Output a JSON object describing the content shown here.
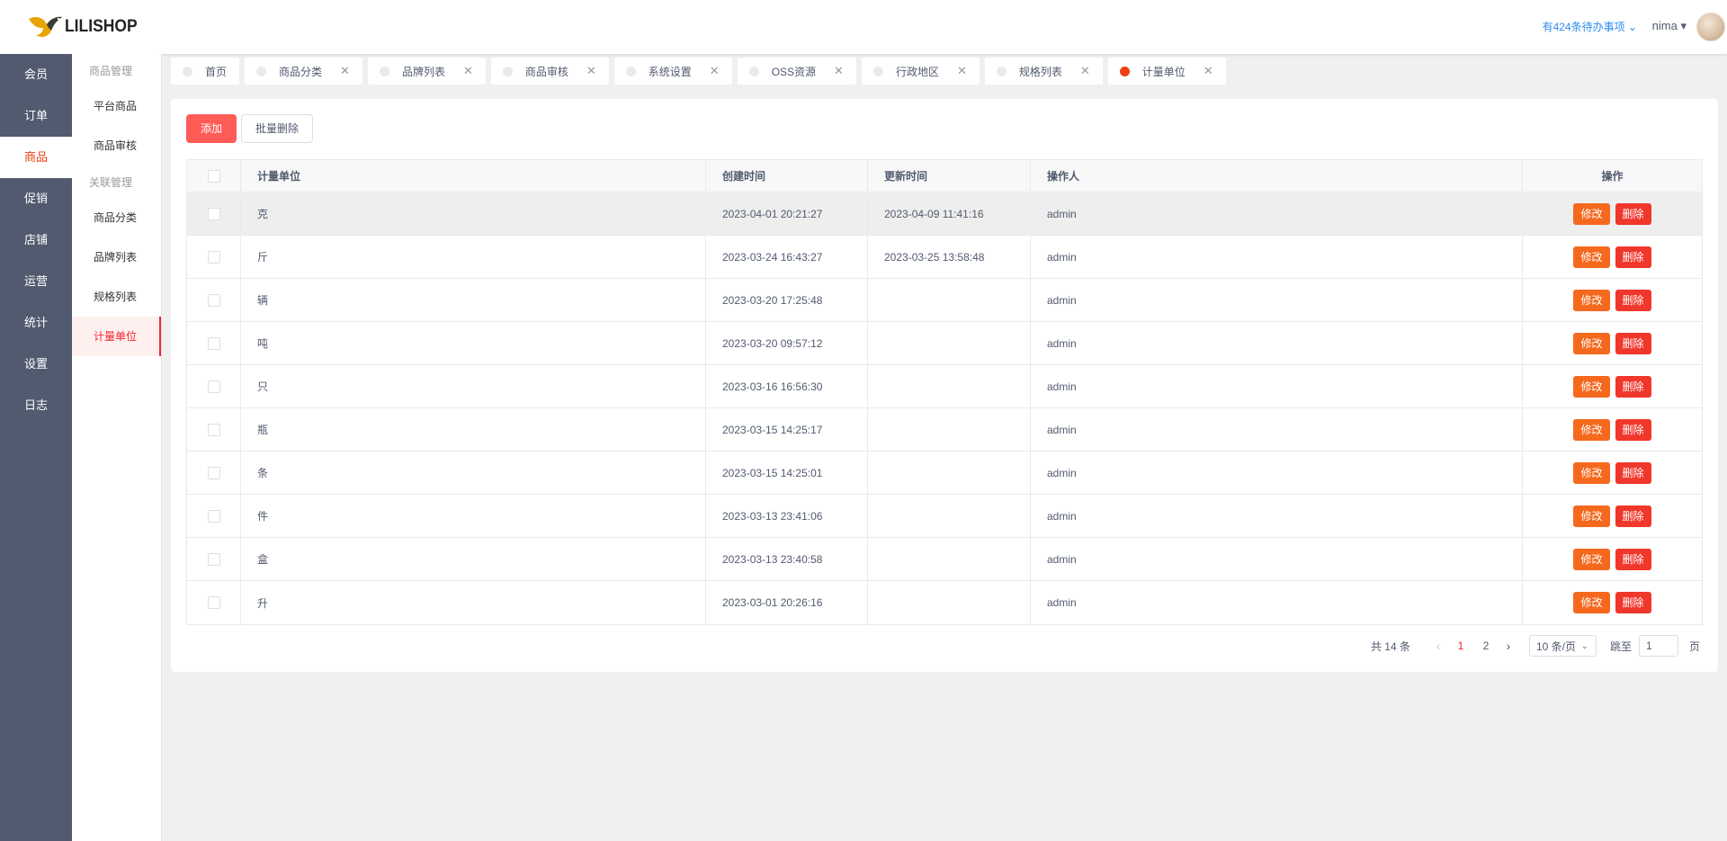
{
  "app": {
    "logo_text": "LILISHOP"
  },
  "header": {
    "todo": "有424条待办事项 ⌄",
    "user": "nima ▾"
  },
  "nav": {
    "items": [
      {
        "label": "会员"
      },
      {
        "label": "订单"
      },
      {
        "label": "商品",
        "active": true
      },
      {
        "label": "促销"
      },
      {
        "label": "店铺"
      },
      {
        "label": "运营"
      },
      {
        "label": "统计"
      },
      {
        "label": "设置"
      },
      {
        "label": "日志"
      }
    ]
  },
  "subnav": {
    "group1": "商品管理",
    "item_platform": "平台商品",
    "item_audit": "商品审核",
    "group2": "关联管理",
    "item_category": "商品分类",
    "item_brand": "品牌列表",
    "item_spec": "规格列表",
    "item_unit": "计量单位"
  },
  "tabs": [
    {
      "label": "首页",
      "closable": false
    },
    {
      "label": "商品分类",
      "closable": true
    },
    {
      "label": "品牌列表",
      "closable": true
    },
    {
      "label": "商品审核",
      "closable": true
    },
    {
      "label": "系统设置",
      "closable": true
    },
    {
      "label": "OSS资源",
      "closable": true
    },
    {
      "label": "行政地区",
      "closable": true
    },
    {
      "label": "规格列表",
      "closable": true
    },
    {
      "label": "计量单位",
      "closable": true,
      "active": true
    }
  ],
  "toolbar": {
    "add_label": "添加",
    "batch_delete_label": "批量删除"
  },
  "table": {
    "headers": {
      "unit": "计量单位",
      "created": "创建时间",
      "updated": "更新时间",
      "operator": "操作人",
      "actions": "操作"
    },
    "edit_label": "修改",
    "delete_label": "删除",
    "rows": [
      {
        "unit": "克",
        "created": "2023-04-01 20:21:27",
        "updated": "2023-04-09 11:41:16",
        "operator": "admin"
      },
      {
        "unit": "斤",
        "created": "2023-03-24 16:43:27",
        "updated": "2023-03-25 13:58:48",
        "operator": "admin"
      },
      {
        "unit": "辆",
        "created": "2023-03-20 17:25:48",
        "updated": "",
        "operator": "admin"
      },
      {
        "unit": "吨",
        "created": "2023-03-20 09:57:12",
        "updated": "",
        "operator": "admin"
      },
      {
        "unit": "只",
        "created": "2023-03-16 16:56:30",
        "updated": "",
        "operator": "admin"
      },
      {
        "unit": "瓶",
        "created": "2023-03-15 14:25:17",
        "updated": "",
        "operator": "admin"
      },
      {
        "unit": "条",
        "created": "2023-03-15 14:25:01",
        "updated": "",
        "operator": "admin"
      },
      {
        "unit": "件",
        "created": "2023-03-13 23:41:06",
        "updated": "",
        "operator": "admin"
      },
      {
        "unit": "盒",
        "created": "2023-03-13 23:40:58",
        "updated": "",
        "operator": "admin"
      },
      {
        "unit": "升",
        "created": "2023-03-01 20:26:16",
        "updated": "",
        "operator": "admin"
      }
    ]
  },
  "pagination": {
    "total": "共 14 条",
    "prev": "‹",
    "page1": "1",
    "page2": "2",
    "next": "›",
    "size": "10 条/页",
    "jump_label": "跳至",
    "jump_value": "1",
    "page_suffix": "页"
  },
  "colors": {
    "accent": "#ff5c58",
    "edit": "#f5691e",
    "delete": "#f0372c",
    "nav_bg": "#515a6e",
    "link": "#2d8cf0"
  }
}
